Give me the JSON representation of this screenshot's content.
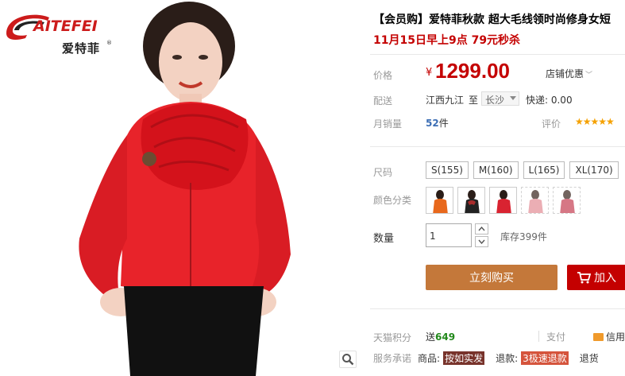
{
  "brand": {
    "logo_text": "AITEFEI",
    "logo_cn": "爱特菲",
    "colors": {
      "brand_red": "#cc1b1b"
    }
  },
  "product": {
    "title": "【会员购】爱特菲秋款 超大毛线领时尚修身女短",
    "subtitle": "11月15日早上9点 79元秒杀",
    "price_label": "价格",
    "currency": "¥",
    "price": "1299.00",
    "promo_label": "店铺优惠",
    "shipping_label": "配送",
    "ship_from": "江西九江",
    "ship_to_prefix": "至",
    "ship_to": "长沙",
    "express": "快递: 0.00",
    "sales_label": "月销量",
    "sales_count": "52",
    "sales_unit": "件",
    "review_label": "评价",
    "stars": "★★★★★",
    "size_label": "尺码",
    "sizes": [
      "S(155)",
      "M(160)",
      "L(165)",
      "XL(170)"
    ],
    "color_label": "颜色分类",
    "color_swatches": [
      "orange-scarf-look",
      "black-scarf-look",
      "red-look",
      "faded-pink-look",
      "faded-red-look"
    ],
    "qty_label": "数量",
    "qty_value": "1",
    "stock": "库存399件",
    "buy_now": "立刻购买",
    "add_cart": "加入",
    "points_label": "天猫积分",
    "points_prefix": "送",
    "points": "649",
    "pay_label": "支付",
    "credit_label": "信用",
    "promise_label": "服务承诺",
    "promise_goods": "商品:",
    "promise_goods_badge": "按如实发",
    "promise_refund": "退款:",
    "promise_refund_badge": "3极速退款",
    "promise_return": "退货"
  },
  "colors": {
    "price_red": "#c40000",
    "buy_now_bg": "#c4783a",
    "cart_bg": "#c40000",
    "points_green": "#22891b",
    "star_orange": "#f5a100"
  }
}
